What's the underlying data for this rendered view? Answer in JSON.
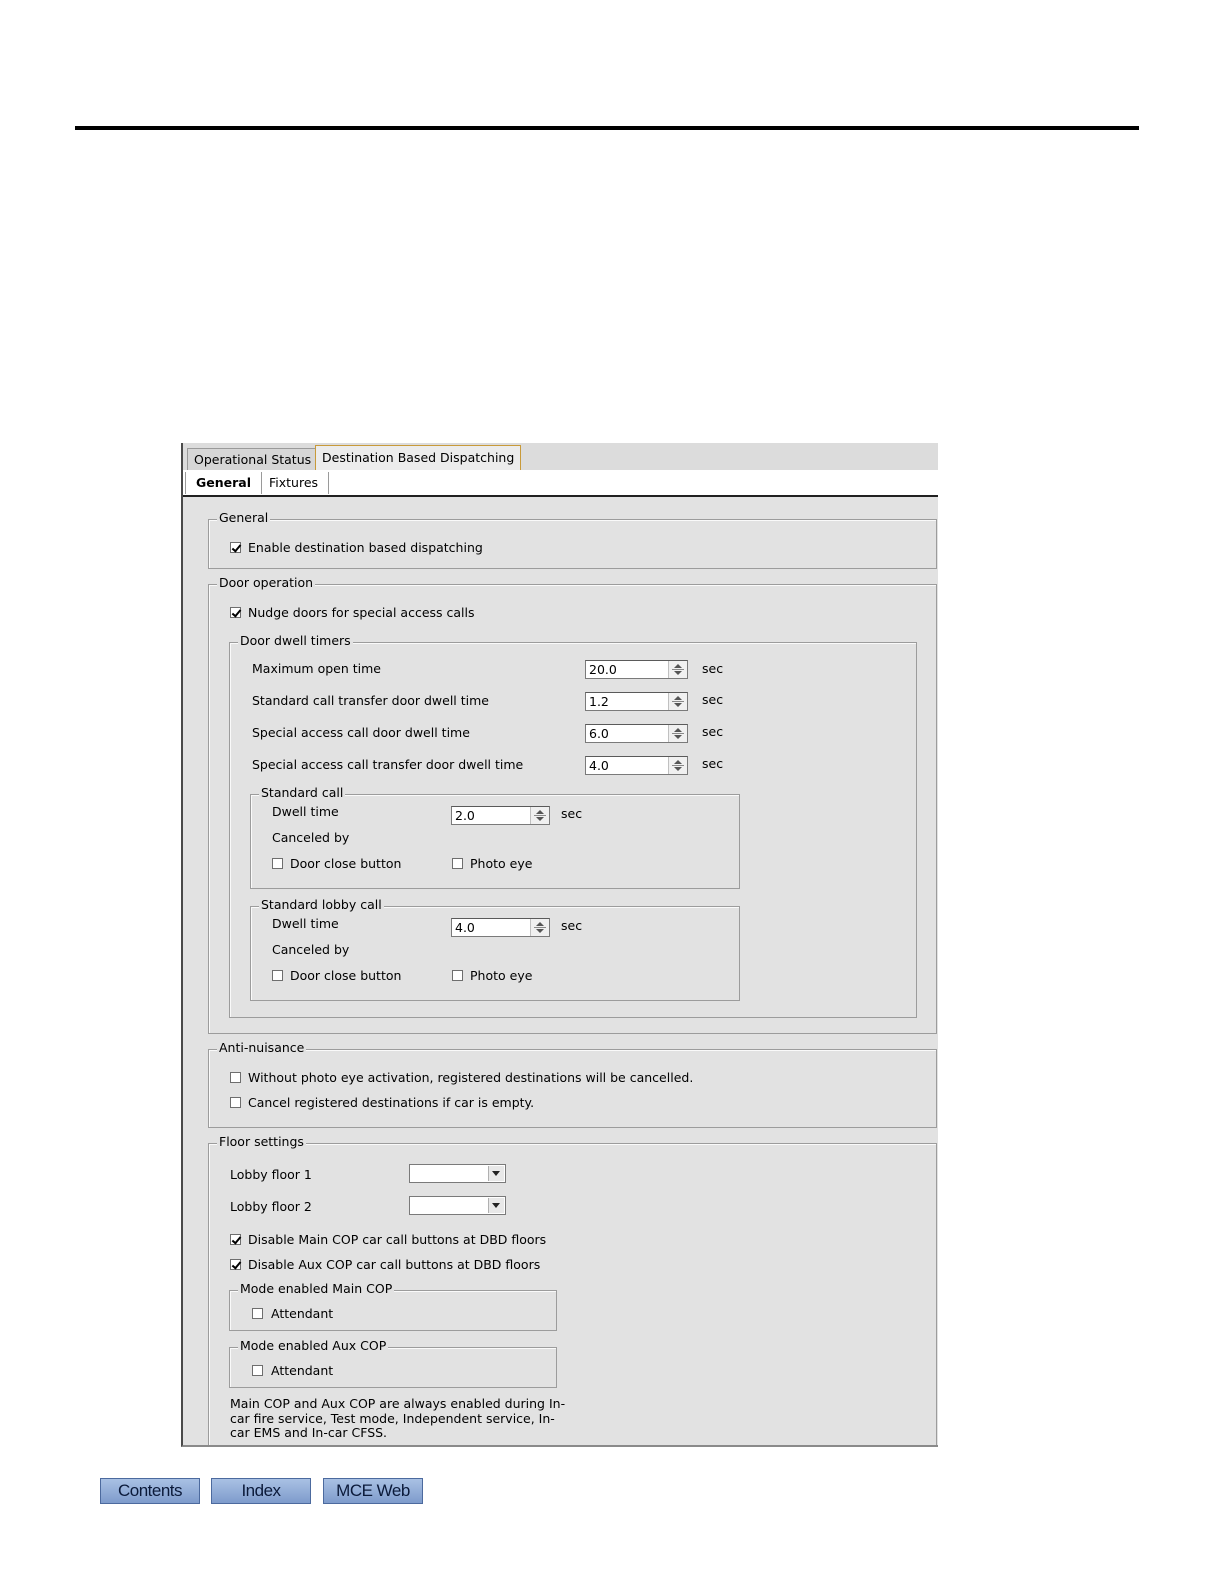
{
  "tabs": [
    {
      "label": "Operational Status",
      "active": false
    },
    {
      "label": "Destination Based Dispatching",
      "active": true
    }
  ],
  "subtabs": [
    {
      "label": "General",
      "active": true
    },
    {
      "label": "Fixtures",
      "active": false
    }
  ],
  "general": {
    "legend": "General",
    "enable_dbd": {
      "label": "Enable destination based dispatching",
      "checked": true
    }
  },
  "door_operation": {
    "legend": "Door operation",
    "nudge": {
      "label": "Nudge doors for special access calls",
      "checked": true
    },
    "dwell_timers": {
      "legend": "Door dwell timers",
      "rows": [
        {
          "label": "Maximum open time",
          "value": "20.0",
          "unit": "sec"
        },
        {
          "label": "Standard call transfer door dwell time",
          "value": "1.2",
          "unit": "sec"
        },
        {
          "label": "Special access call door dwell time",
          "value": "6.0",
          "unit": "sec"
        },
        {
          "label": "Special access call transfer door dwell time",
          "value": "4.0",
          "unit": "sec"
        }
      ]
    },
    "standard_call": {
      "legend": "Standard call",
      "dwell_label": "Dwell time",
      "dwell_value": "2.0",
      "unit": "sec",
      "canceled_by": "Canceled by",
      "door_close": {
        "label": "Door close button",
        "checked": false
      },
      "photo_eye": {
        "label": "Photo eye",
        "checked": false
      }
    },
    "standard_lobby_call": {
      "legend": "Standard lobby call",
      "dwell_label": "Dwell time",
      "dwell_value": "4.0",
      "unit": "sec",
      "canceled_by": "Canceled by",
      "door_close": {
        "label": "Door close button",
        "checked": false
      },
      "photo_eye": {
        "label": "Photo eye",
        "checked": false
      }
    }
  },
  "anti_nuisance": {
    "legend": "Anti-nuisance",
    "photo_eye": {
      "label": "Without photo eye activation, registered destinations will be cancelled.",
      "checked": false
    },
    "car_empty": {
      "label": "Cancel registered destinations if car is empty.",
      "checked": false
    }
  },
  "floor_settings": {
    "legend": "Floor settings",
    "lobby1": {
      "label": "Lobby floor 1",
      "value": ""
    },
    "lobby2": {
      "label": "Lobby floor 2",
      "value": ""
    },
    "disable_main": {
      "label": "Disable Main COP car call buttons at DBD floors",
      "checked": true
    },
    "disable_aux": {
      "label": "Disable Aux COP car call buttons at DBD floors",
      "checked": true
    },
    "mode_main": {
      "legend": "Mode enabled Main COP",
      "attendant": {
        "label": "Attendant",
        "checked": false
      }
    },
    "mode_aux": {
      "legend": "Mode enabled Aux COP",
      "attendant": {
        "label": "Attendant",
        "checked": false
      }
    },
    "note_lines": [
      "Main COP and Aux COP are always enabled during In-",
      "car fire service, Test mode, Independent service, In-",
      "car EMS and In-car CFSS."
    ]
  },
  "nav": {
    "contents": "Contents",
    "index": "Index",
    "mce_web": "MCE Web"
  }
}
